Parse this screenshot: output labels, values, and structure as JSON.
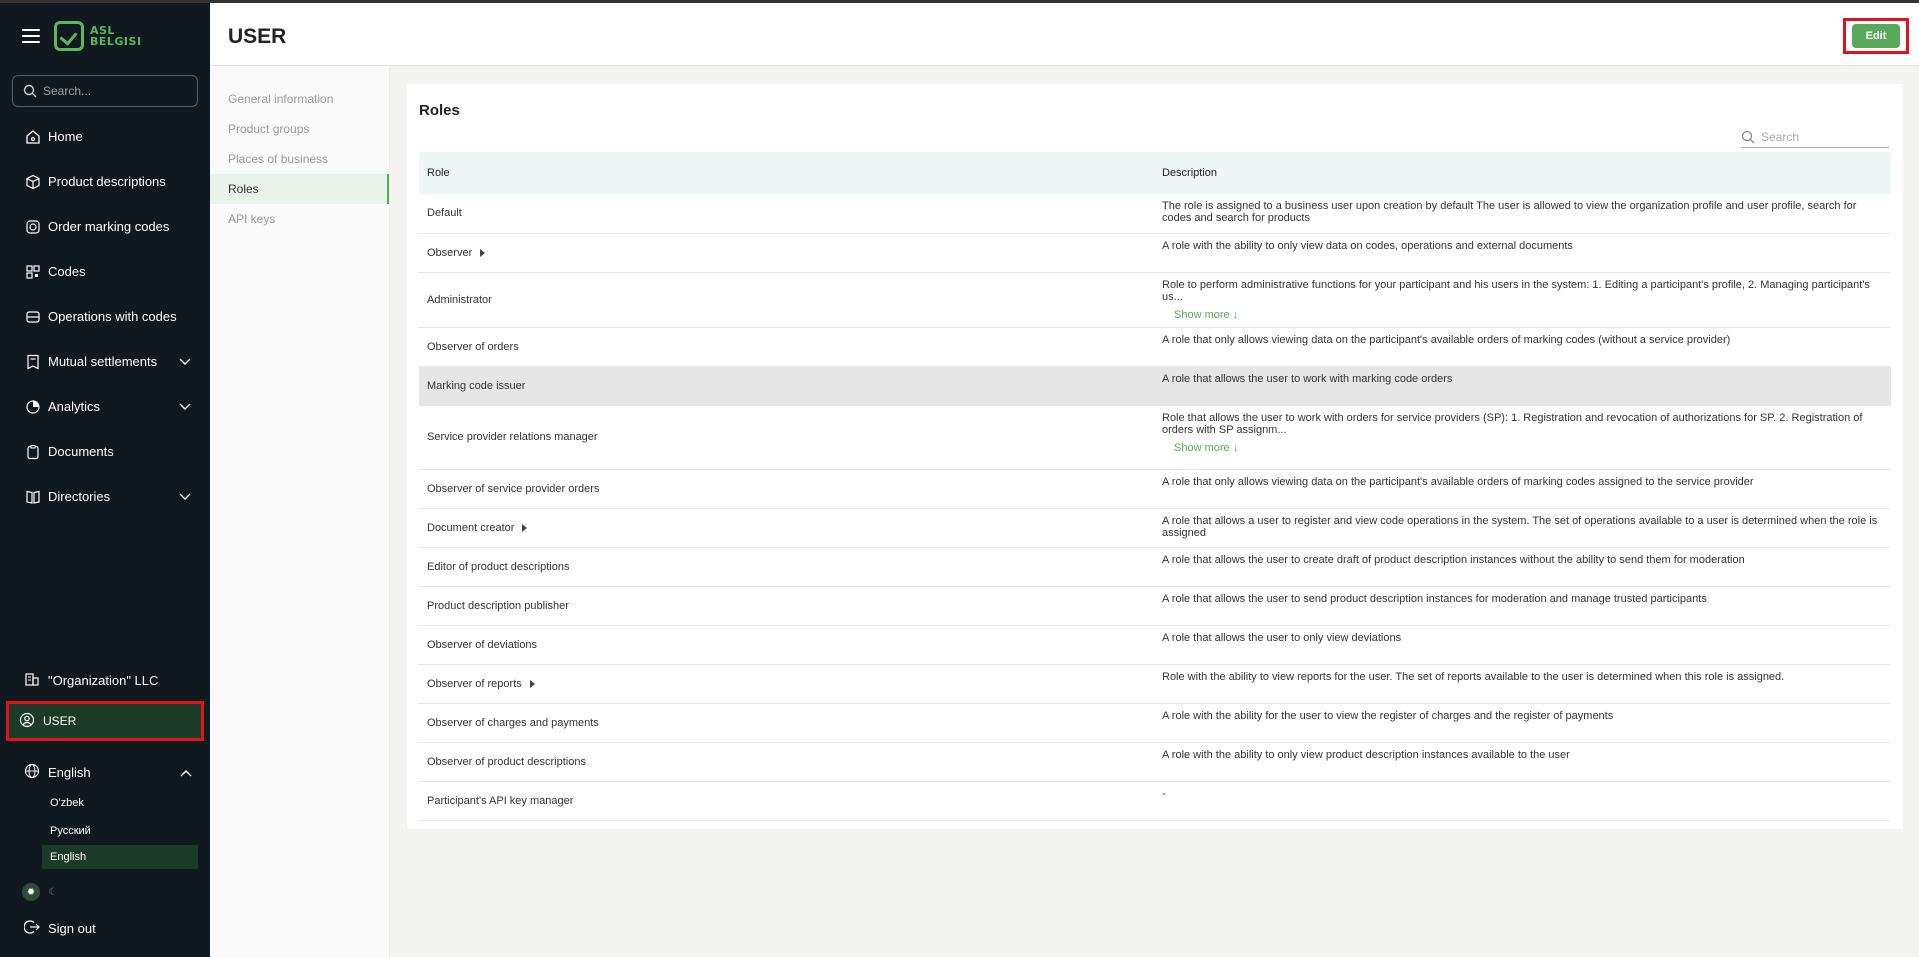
{
  "brand": {
    "logo_text_line1": "ASL",
    "logo_text_line2": "BELGISI",
    "accent": "#58a95a"
  },
  "sidebar": {
    "search_placeholder": "Search...",
    "items": [
      {
        "label": "Home",
        "icon": "home-icon",
        "expandable": false
      },
      {
        "label": "Product descriptions",
        "icon": "box-icon",
        "expandable": false
      },
      {
        "label": "Order marking codes",
        "icon": "order-icon",
        "expandable": false
      },
      {
        "label": "Codes",
        "icon": "codes-icon",
        "expandable": false
      },
      {
        "label": "Operations with codes",
        "icon": "operations-icon",
        "expandable": false
      },
      {
        "label": "Mutual settlements",
        "icon": "receipt-icon",
        "expandable": true
      },
      {
        "label": "Analytics",
        "icon": "analytics-icon",
        "expandable": true
      },
      {
        "label": "Documents",
        "icon": "documents-icon",
        "expandable": false
      },
      {
        "label": "Directories",
        "icon": "book-icon",
        "expandable": true
      }
    ],
    "organization": "\"Organization\" LLC",
    "user": "USER",
    "language": {
      "current": "English",
      "options": [
        "O'zbek",
        "Русский",
        "English"
      ]
    },
    "sign_out": "Sign out"
  },
  "header": {
    "title": "USER",
    "edit_label": "Edit"
  },
  "subnav": {
    "items": [
      "General information",
      "Product groups",
      "Places of business",
      "Roles",
      "API keys"
    ],
    "active": "Roles"
  },
  "roles_card": {
    "title": "Roles",
    "search_placeholder": "Search",
    "columns": [
      "Role",
      "Description"
    ],
    "show_more": "Show more ↓",
    "rows": [
      {
        "role": "Default",
        "description": "The role is assigned to a business user upon creation by default The user is allowed to view the organization profile and user profile, search for codes and search for products"
      },
      {
        "role": "Observer",
        "description": "A role with the ability to only view data on codes, operations and external documents"
      },
      {
        "role": "Administrator",
        "description": "Role to perform administrative functions for your participant and his users in the system: 1. Editing a participant's profile, 2. Managing participant's us..."
      },
      {
        "role": "Observer of orders",
        "description": "A role that only allows viewing data on the participant's available orders of marking codes (without a service provider)"
      },
      {
        "role": "Marking code issuer",
        "description": "A role that allows the user to work with marking code orders"
      },
      {
        "role": "Service provider relations manager",
        "description": "Role that allows the user to work with orders for service providers (SP): 1. Registration and revocation of authorizations for SP. 2. Registration of orders with SP assignm..."
      },
      {
        "role": "Observer of service provider orders",
        "description": "A role that only allows viewing data on the participant's available orders of marking codes assigned to the service provider"
      },
      {
        "role": "Document creator",
        "description": "A role that allows a user to register and view code operations in the system. The set of operations available to a user is determined when the role is assigned"
      },
      {
        "role": "Editor of product descriptions",
        "description": "A role that allows the user to create draft of product description instances without the ability to send them for moderation"
      },
      {
        "role": "Product description publisher",
        "description": "A role that allows the user to send product description instances for moderation and manage trusted participants"
      },
      {
        "role": "Observer of deviations",
        "description": "A role that allows the user to only view deviations"
      },
      {
        "role": "Observer of reports",
        "description": "Role with the ability to view reports for the user. The set of reports available to the user is determined when this role is assigned."
      },
      {
        "role": "Observer of charges and payments",
        "description": "A role with the ability for the user to view the register of charges and the register of payments"
      },
      {
        "role": "Observer of product descriptions",
        "description": "A role with the ability to only view product description instances available to the user"
      },
      {
        "role": "Participant's API key manager",
        "description": "-"
      }
    ]
  }
}
